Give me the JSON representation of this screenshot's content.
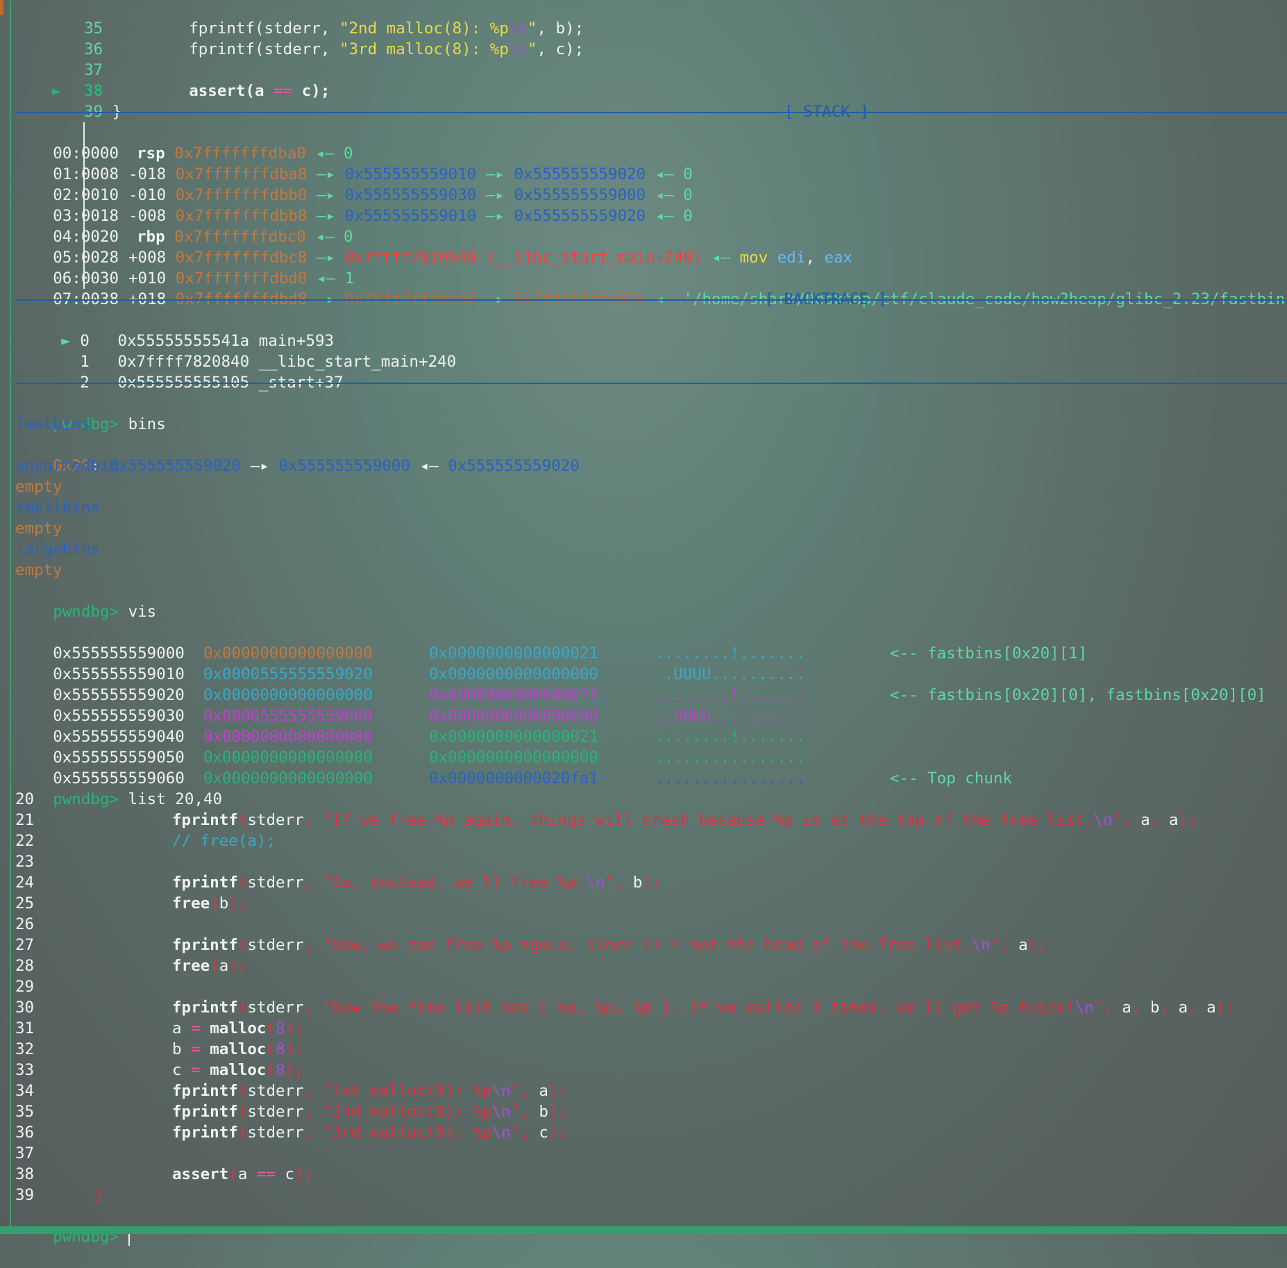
{
  "top_source": [
    {
      "num": "35",
      "code": "fprintf(stderr, \"2nd malloc(8): %p\\n\", b);"
    },
    {
      "num": "36",
      "code": "fprintf(stderr, \"3rd malloc(8): %p\\n\", c);"
    },
    {
      "num": "37",
      "code": ""
    },
    {
      "num": "38",
      "code": "assert(a == c);",
      "current": true
    },
    {
      "num": "39",
      "code": "}"
    }
  ],
  "current_marker": "►",
  "stack": {
    "title": "[ STACK ]",
    "rows": [
      {
        "idx": "00:0000",
        "off": "rsp",
        "addr": "0x7fffffffdba0",
        "tail": "◂— 0"
      },
      {
        "idx": "01:0008",
        "off": "-018",
        "addr": "0x7fffffffdba8",
        "tail": "—▸ 0x555555559010 —▸ 0x555555559020 ◂— 0"
      },
      {
        "idx": "02:0010",
        "off": "-010",
        "addr": "0x7fffffffdbb0",
        "tail": "—▸ 0x555555559030 —▸ 0x555555559000 ◂— 0"
      },
      {
        "idx": "03:0018",
        "off": "-008",
        "addr": "0x7fffffffdbb8",
        "tail": "—▸ 0x555555559010 —▸ 0x555555559020 ◂— 0"
      },
      {
        "idx": "04:0020",
        "off": "rbp",
        "addr": "0x7fffffffdbc0",
        "tail": "◂— 0"
      },
      {
        "idx": "05:0028",
        "off": "+008",
        "addr": "0x7fffffffdbc8",
        "tail": "—▸ 0x7ffff7820840 (__libc_start_main+240) ◂— mov edi, eax"
      },
      {
        "idx": "06:0030",
        "off": "+010",
        "addr": "0x7fffffffdbd0",
        "tail": "◂— 1"
      },
      {
        "idx": "07:0038",
        "off": "+018",
        "addr": "0x7fffffffdbd8",
        "tail": "—▸ 0x7fffffffdca8 —▸ 0x7fffffffe02d ◂— '/home/shark/Desktop/ctf/claude_code/how2heap/glibc_2.23/fastbin"
      }
    ]
  },
  "backtrace": {
    "title": "[ BACKTRACE ]",
    "frames": [
      {
        "marker": "►",
        "n": "0",
        "addr": "0x55555555541a",
        "sym": "main+593"
      },
      {
        "marker": "",
        "n": "1",
        "addr": "0x7ffff7820840",
        "sym": "__libc_start_main+240"
      },
      {
        "marker": "",
        "n": "2",
        "addr": "0x555555555105",
        "sym": "_start+37"
      }
    ]
  },
  "prompt": "pwndbg>",
  "cmd_bins": "bins",
  "bins": {
    "fastbins": "fastbins",
    "fast_size": "0x20",
    "fast_chain": [
      "0x555555559020",
      "0x555555559000",
      "0x555555559020"
    ],
    "unsortedbin": "unsortedbin",
    "smallbins": "smallbins",
    "largebins": "largebins",
    "empty": "empty"
  },
  "cmd_vis": "vis",
  "vis_rows": [
    {
      "addr": "0x555555559000",
      "w1": "0x0000000000000000",
      "w2": "0x0000000000000021",
      "ascii": "........!.......",
      "note": "<-- fastbins[0x20][1]"
    },
    {
      "addr": "0x555555559010",
      "w1": "0x0000555555559020",
      "w2": "0x0000000000000000",
      "ascii": " .UUUU..........",
      "note": ""
    },
    {
      "addr": "0x555555559020",
      "w1": "0x0000000000000000",
      "w2": "0x0000000000000021",
      "ascii": "........!.......",
      "note": "<-- fastbins[0x20][0], fastbins[0x20][0]"
    },
    {
      "addr": "0x555555559030",
      "w1": "0x0000555555559000",
      "w2": "0x0000000000000000",
      "ascii": "..UUUU..........",
      "note": ""
    },
    {
      "addr": "0x555555559040",
      "w1": "0x0000000000000000",
      "w2": "0x0000000000000021",
      "ascii": "........!.......",
      "note": ""
    },
    {
      "addr": "0x555555559050",
      "w1": "0x0000000000000000",
      "w2": "0x0000000000000000",
      "ascii": "................",
      "note": ""
    },
    {
      "addr": "0x555555559060",
      "w1": "0x0000000000000000",
      "w2": "0x0000000000020fa1",
      "ascii": "................",
      "note": "<-- Top chunk"
    }
  ],
  "cmd_list": "list 20,40",
  "list_source": [
    {
      "num": "20",
      "code": ""
    },
    {
      "num": "21",
      "code": "fprintf(stderr, \"If we free %p again, things will crash because %p is at the top of the free list.\\n\", a, a);"
    },
    {
      "num": "22",
      "code": "// free(a);"
    },
    {
      "num": "23",
      "code": ""
    },
    {
      "num": "24",
      "code": "fprintf(stderr, \"So, instead, we'll free %p.\\n\", b);"
    },
    {
      "num": "25",
      "code": "free(b);"
    },
    {
      "num": "26",
      "code": ""
    },
    {
      "num": "27",
      "code": "fprintf(stderr, \"Now, we can free %p again, since it's not the head of the free list.\\n\", a);"
    },
    {
      "num": "28",
      "code": "free(a);"
    },
    {
      "num": "29",
      "code": ""
    },
    {
      "num": "30",
      "code": "fprintf(stderr, \"Now the free list has [ %p, %p, %p ]. If we malloc 3 times, we'll get %p twice!\\n\", a, b, a, a);"
    },
    {
      "num": "31",
      "code": "a = malloc(8);"
    },
    {
      "num": "32",
      "code": "b = malloc(8);"
    },
    {
      "num": "33",
      "code": "c = malloc(8);"
    },
    {
      "num": "34",
      "code": "fprintf(stderr, \"1st malloc(8): %p\\n\", a);"
    },
    {
      "num": "35",
      "code": "fprintf(stderr, \"2nd malloc(8): %p\\n\", b);"
    },
    {
      "num": "36",
      "code": "fprintf(stderr, \"3rd malloc(8): %p\\n\", c);"
    },
    {
      "num": "37",
      "code": ""
    },
    {
      "num": "38",
      "code": "assert(a == c);"
    },
    {
      "num": "39",
      "code": "}"
    }
  ]
}
